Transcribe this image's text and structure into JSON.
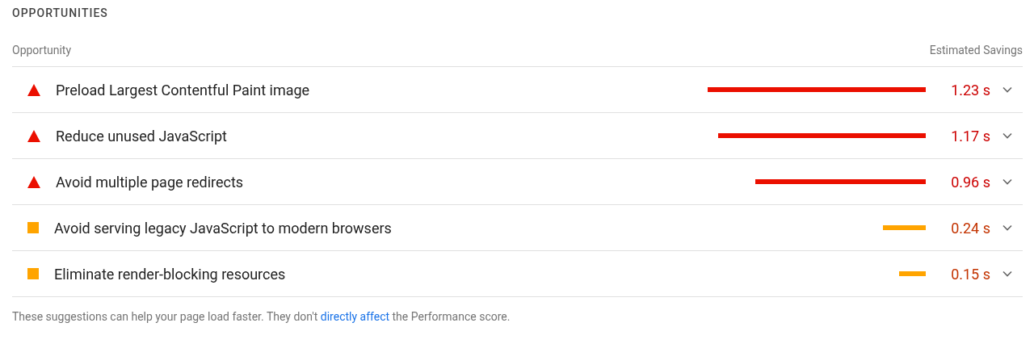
{
  "section_title": "OPPORTUNITIES",
  "table": {
    "columns": [
      "Opportunity",
      "Estimated Savings"
    ],
    "rows": [
      {
        "kind": "fail",
        "title": "Preload Largest Contentful Paint image",
        "savings": "1.23 s",
        "expanded": false
      },
      {
        "kind": "fail",
        "title": "Reduce unused JavaScript",
        "savings": "1.17 s",
        "expanded": false
      },
      {
        "kind": "fail",
        "title": "Avoid multiple page redirects",
        "savings": "0.96 s",
        "expanded": false
      },
      {
        "kind": "average",
        "title": "Avoid serving legacy JavaScript to modern browsers",
        "savings": "0.24 s",
        "expanded": false
      },
      {
        "kind": "average",
        "title": "Eliminate render-blocking resources",
        "savings": "0.15 s",
        "expanded": false
      }
    ]
  },
  "footer": {
    "before": "These suggestions can help your page load faster. They don't ",
    "link": "directly affect",
    "after": " the Performance score."
  }
}
